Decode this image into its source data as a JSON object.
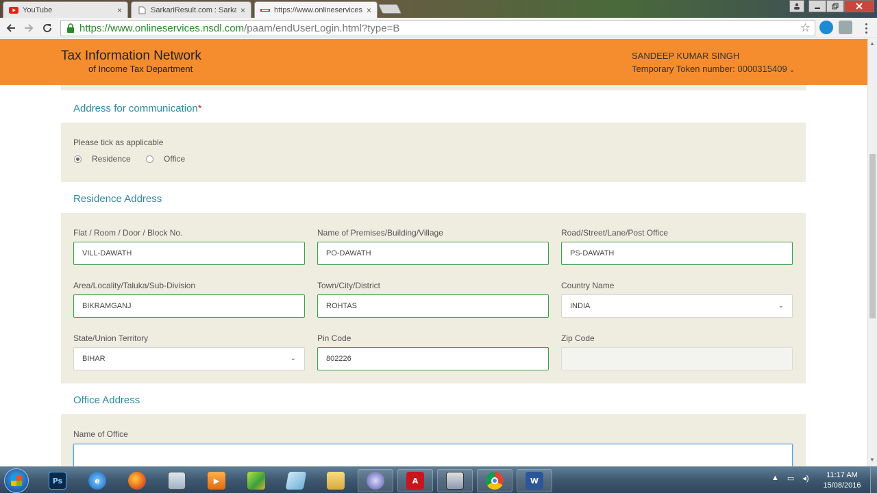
{
  "browser": {
    "tabs": [
      {
        "label": "YouTube",
        "icon": "youtube-icon"
      },
      {
        "label": "SarkariResult.com : Sarkari",
        "icon": "page-icon"
      },
      {
        "label": "https://www.onlineservices",
        "icon": "nsdl-icon",
        "active": true
      }
    ],
    "close_glyph": "×",
    "url_host": "https://www.onlineservices.nsdl.com",
    "url_path": "/paam/endUserLogin.html?type=B"
  },
  "header": {
    "brand_line1": "Tax Information Network",
    "brand_line2": "of Income Tax Department",
    "user_name": "SANDEEP KUMAR SINGH",
    "token_text": "Temporary Token number: 0000315409"
  },
  "communication": {
    "title": "Address for communication",
    "required_mark": "*",
    "instruction": "Please tick as applicable",
    "options": [
      {
        "label": "Residence",
        "selected": true
      },
      {
        "label": "Office",
        "selected": false
      }
    ]
  },
  "residence": {
    "title": "Residence Address",
    "fields": [
      {
        "label": "Flat / Room / Door / Block No.",
        "value": "VILL-DAWATH"
      },
      {
        "label": "Name of Premises/Building/Village",
        "value": "PO-DAWATH"
      },
      {
        "label": "Road/Street/Lane/Post Office",
        "value": "PS-DAWATH"
      },
      {
        "label": "Area/Locality/Taluka/Sub-Division",
        "value": "BIKRAMGANJ"
      },
      {
        "label": "Town/City/District",
        "value": "ROHTAS"
      },
      {
        "label": "Country Name",
        "value": "INDIA"
      },
      {
        "label": "State/Union Territory",
        "value": "BIHAR"
      },
      {
        "label": "Pin Code",
        "value": "802226"
      },
      {
        "label": "Zip Code",
        "value": ""
      }
    ]
  },
  "office": {
    "title": "Office Address",
    "name_label": "Name of Office",
    "name_value": ""
  },
  "taskbar": {
    "time": "11:17 AM",
    "date": "15/08/2016"
  },
  "colors": {
    "header_orange": "#f58d2f",
    "section_title": "#2d8aa3",
    "field_valid_border": "#3aa04a",
    "strip_bg": "#efece0"
  }
}
